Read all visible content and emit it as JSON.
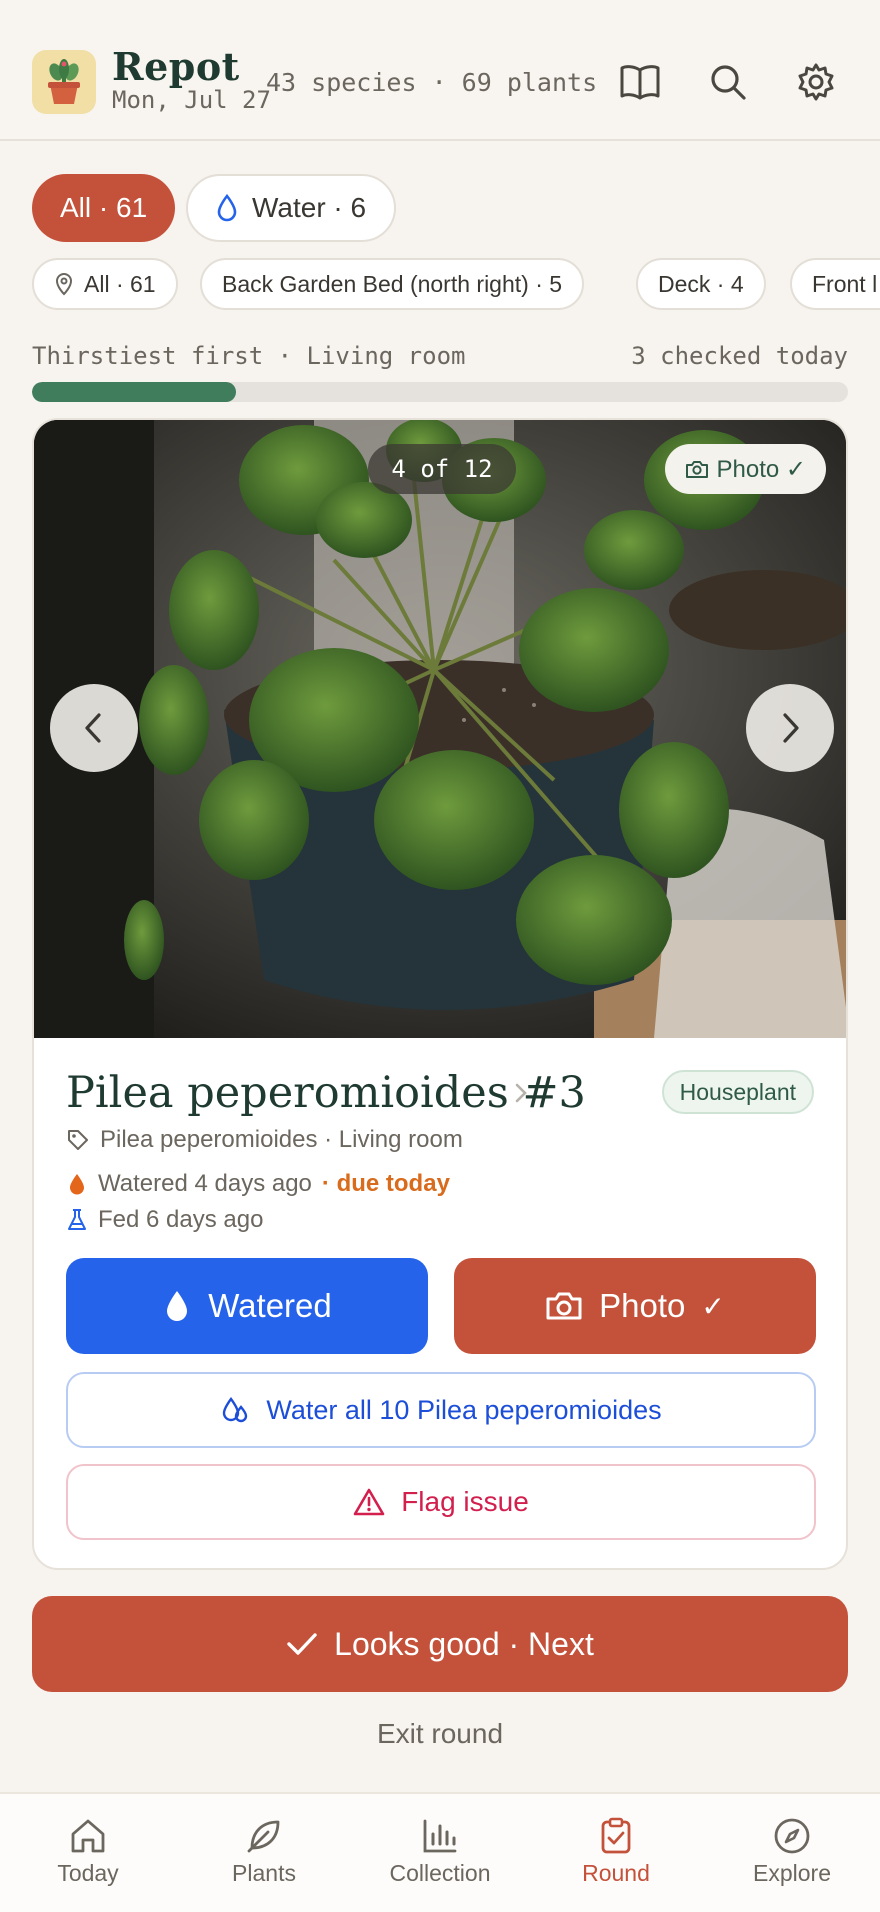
{
  "header": {
    "app_name": "Repot",
    "date": "Mon, Jul 27",
    "stats": "43 species · 69 plants",
    "icons": [
      "book-icon",
      "search-icon",
      "gear-icon"
    ]
  },
  "filters": {
    "status_chips": [
      {
        "label": "All · 61",
        "active": true
      },
      {
        "label": "Water · 6",
        "icon": "water-drop-icon"
      }
    ],
    "location_chips": [
      {
        "label": "All · 61",
        "icon": "location-pin-icon"
      },
      {
        "label": "Back Garden Bed (north right) · 5"
      },
      {
        "label": "Deck · 4"
      },
      {
        "label": "Front l"
      }
    ]
  },
  "round": {
    "sort_label": "Thirstiest first · Living room",
    "checked_label": "3 checked today",
    "progress": 0.25
  },
  "card": {
    "counter": "4 of 12",
    "photo_badge": "Photo ✓",
    "plant_name": "Pilea peperomioides #3",
    "tag": "Houseplant",
    "species_line": "Pilea peperomioides · Living room",
    "watered_text": "Watered 4 days ago",
    "due_text": "· due today",
    "fed_text": "Fed 6 days ago",
    "watered_button": "Watered",
    "photo_button": "Photo",
    "photo_button_check": "✓",
    "water_all_button": "Water all 10 Pilea peperomioides",
    "flag_button": "Flag issue"
  },
  "actions": {
    "next_button": "Looks good · Next",
    "exit_button": "Exit round"
  },
  "bottom_nav": [
    {
      "label": "Today",
      "icon": "home-icon"
    },
    {
      "label": "Plants",
      "icon": "leaf-icon"
    },
    {
      "label": "Collection",
      "icon": "bar-chart-icon"
    },
    {
      "label": "Round",
      "icon": "clipboard-check-icon",
      "active": true
    },
    {
      "label": "Explore",
      "icon": "compass-icon"
    }
  ],
  "colors": {
    "accent": "#c4523b",
    "blue": "#2563eb",
    "green": "#3f7d5c",
    "danger": "#d21f4e",
    "due": "#d96b1c"
  }
}
